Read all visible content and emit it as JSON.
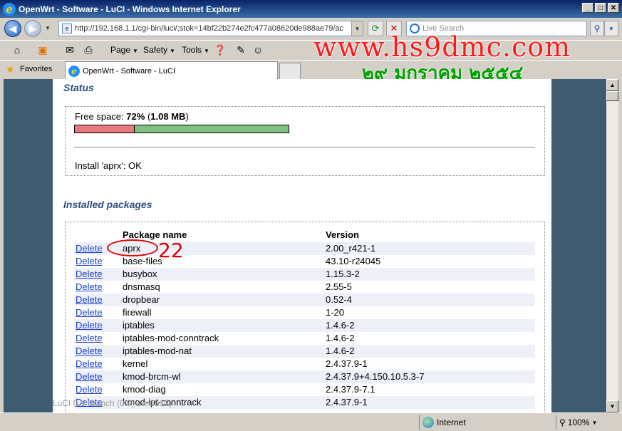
{
  "window": {
    "title": "OpenWrt - Software - LuCI - Windows Internet Explorer"
  },
  "nav": {
    "url": "http://192.168.1.1/cgi-bin/luci/;stok=14bf22b274e2fc477a08620de988ae79/ac",
    "search_placeholder": "Live Search"
  },
  "commandbar": {
    "page": "Page",
    "safety": "Safety",
    "tools": "Tools"
  },
  "favorites": {
    "label": "Favorites",
    "tab_title": "OpenWrt - Software - LuCI"
  },
  "watermark": {
    "site": "www.hs9dmc.com",
    "date": "๒๙ มกราคม ๒๕๕๔"
  },
  "status": {
    "heading": "Status",
    "free_label": "Free space:",
    "free_percent": "72%",
    "free_size": "(1.08 MB)",
    "free_open": "(",
    "free_size_value": "1.08 MB",
    "free_close": ")",
    "used_fraction": 0.28,
    "install_message": "Install 'aprx': OK"
  },
  "packages": {
    "heading": "Installed packages",
    "col_name": "Package name",
    "col_version": "Version",
    "delete_label": "Delete",
    "rows": [
      {
        "name": "aprx",
        "version": "2.00_r421-1"
      },
      {
        "name": "base-files",
        "version": "43.10-r24045"
      },
      {
        "name": "busybox",
        "version": "1.15.3-2"
      },
      {
        "name": "dnsmasq",
        "version": "2.55-5"
      },
      {
        "name": "dropbear",
        "version": "0.52-4"
      },
      {
        "name": "firewall",
        "version": "1-20"
      },
      {
        "name": "iptables",
        "version": "1.4.6-2"
      },
      {
        "name": "iptables-mod-conntrack",
        "version": "1.4.6-2"
      },
      {
        "name": "iptables-mod-nat",
        "version": "1.4.6-2"
      },
      {
        "name": "kernel",
        "version": "2.4.37.9-1"
      },
      {
        "name": "kmod-brcm-wl",
        "version": "2.4.37.9+4.150.10.5.3-7"
      },
      {
        "name": "kmod-diag",
        "version": "2.4.37.9-7.1"
      },
      {
        "name": "kmod-ipt-conntrack",
        "version": "2.4.37.9-1"
      }
    ]
  },
  "annotation": {
    "number": "22"
  },
  "footer": {
    "text": "LuCI 0.9 Branch (0.9+svn6512)"
  },
  "statusbar": {
    "zone": "Internet",
    "zoom": "100%"
  }
}
